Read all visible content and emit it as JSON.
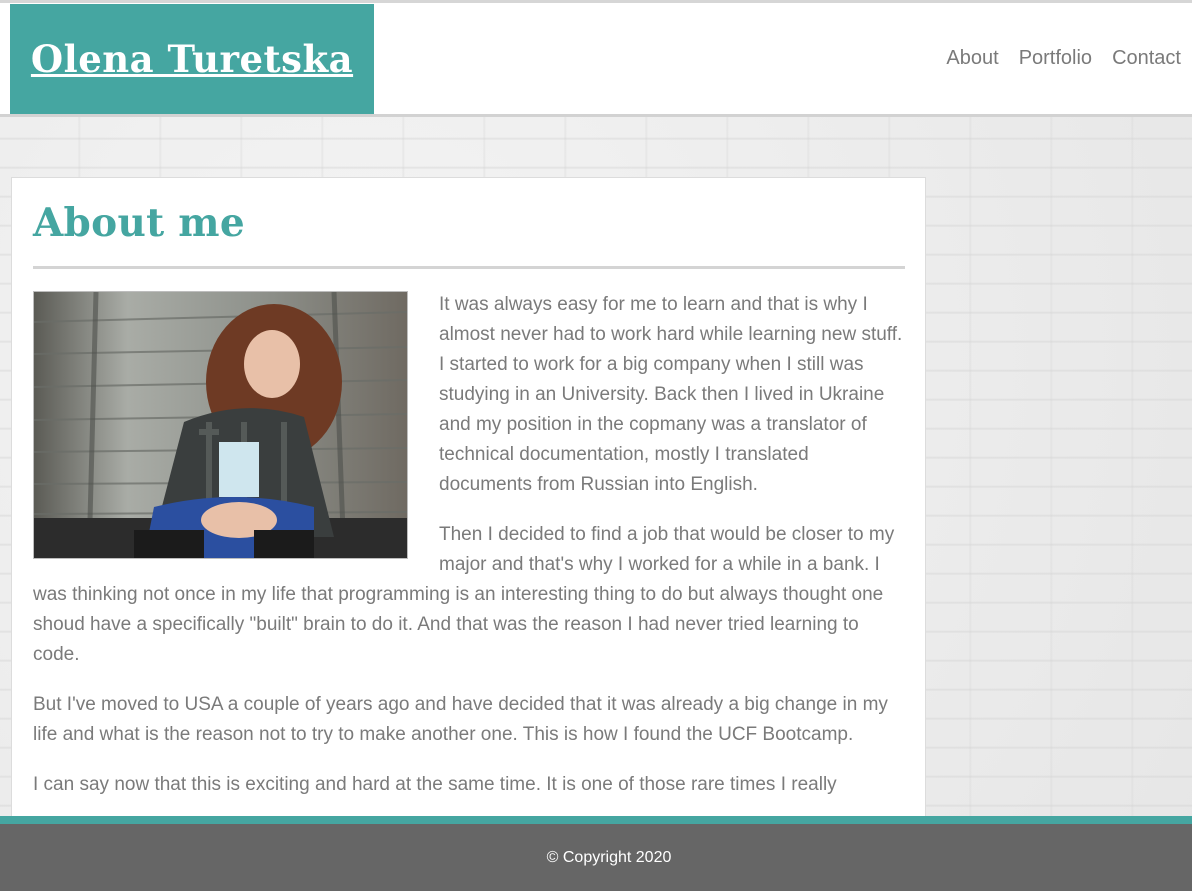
{
  "header": {
    "brand_name": "Olena Turetska",
    "brand_color": "#45a6a1",
    "nav": [
      {
        "label": "About"
      },
      {
        "label": "Portfolio"
      },
      {
        "label": "Contact"
      }
    ]
  },
  "main": {
    "title": "About me",
    "photo_alt": "Portrait of Olena Turetska",
    "paragraphs": [
      "It was always easy for me to learn and that is why I almost never had to work hard while learning new stuff. I started to work for a big company when I still was studying in an University. Back then I lived in Ukraine and my position in the copmany was a translator of technical documentation, mostly I translated documents from Russian into English.",
      "Then I decided to find a job that would be closer to my major and that's why I worked for a while in a bank. I was thinking not once in my life that programming is an interesting thing to do but always thought one shoud have a specifically \"built\" brain to do it. And that was the reason I had never tried learning to code.",
      "But I've moved to USA a couple of years ago and have decided that it was already a big change in my life and what is the reason not to try to make another one. This is how I found the UCF Bootcamp.",
      "I can say now that this is exciting and hard at the same time. It is one of those rare times I really"
    ]
  },
  "footer": {
    "copyright": "© Copyright 2020"
  }
}
